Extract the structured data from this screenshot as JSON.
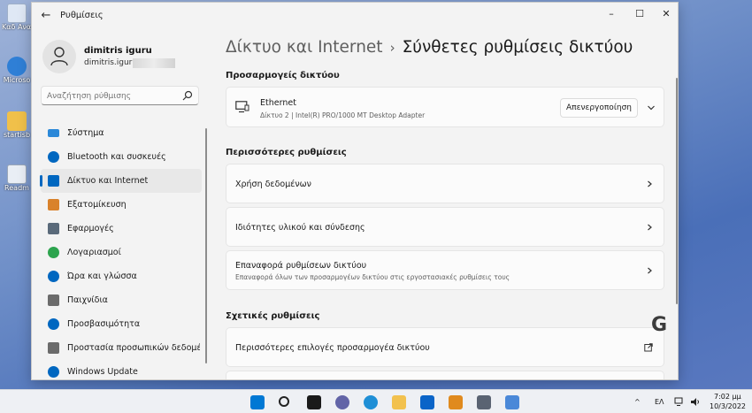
{
  "desktop": {
    "icons": [
      {
        "label": "Καδ Ανακύκλ",
        "color": "#dfe8f5"
      },
      {
        "label": "Microso",
        "color": "#2f7fd6"
      },
      {
        "label": "startisb",
        "color": "#f0c04a"
      },
      {
        "label": "Readm",
        "color": "#e9eef5"
      }
    ]
  },
  "window": {
    "title": "Ρυθμίσεις",
    "back_icon": "back-arrow-icon",
    "controls": {
      "minimize": "–",
      "maximize": "☐",
      "close": "✕"
    }
  },
  "user": {
    "name": "dimitris iguru",
    "email": "dimitris.iguru@"
  },
  "search": {
    "placeholder": "Αναζήτηση ρύθμισης"
  },
  "sidebar": {
    "items": [
      {
        "label": "Σύστημα",
        "icon": "monitor-icon",
        "color": "#2b88d8"
      },
      {
        "label": "Bluetooth και συσκευές",
        "icon": "bluetooth-icon",
        "color": "#0067c0"
      },
      {
        "label": "Δίκτυο και Internet",
        "icon": "wifi-icon",
        "color": "#0067c0",
        "active": true
      },
      {
        "label": "Εξατομίκευση",
        "icon": "brush-icon",
        "color": "#d9822b"
      },
      {
        "label": "Εφαρμογές",
        "icon": "apps-icon",
        "color": "#5a6a7a"
      },
      {
        "label": "Λογαριασμοί",
        "icon": "person-icon",
        "color": "#2da44e"
      },
      {
        "label": "Ώρα και γλώσσα",
        "icon": "globe-clock-icon",
        "color": "#0067c0"
      },
      {
        "label": "Παιχνίδια",
        "icon": "gamepad-icon",
        "color": "#6b6b6b"
      },
      {
        "label": "Προσβασιμότητα",
        "icon": "accessibility-icon",
        "color": "#0067c0"
      },
      {
        "label": "Προστασία προσωπικών δεδομέ",
        "icon": "shield-icon",
        "color": "#6b6b6b"
      },
      {
        "label": "Windows Update",
        "icon": "update-icon",
        "color": "#0067c0"
      }
    ]
  },
  "main": {
    "breadcrumb_parent": "Δίκτυο και Internet",
    "breadcrumb_sep": "›",
    "page_title": "Σύνθετες ρυθμίσεις δικτύου",
    "adapters_label": "Προσαρμογείς δικτύου",
    "adapter": {
      "name": "Ethernet",
      "detail": "Δίκτυο 2 | Intel(R) PRO/1000 MT Desktop Adapter",
      "button": "Απενεργοποίηση"
    },
    "more_label": "Περισσότερες ρυθμίσεις",
    "more_items": [
      {
        "title": "Χρήση δεδομένων",
        "sub": ""
      },
      {
        "title": "Ιδιότητες υλικού και σύνδεσης",
        "sub": ""
      },
      {
        "title": "Επαναφορά ρυθμίσεων δικτύου",
        "sub": "Επαναφορά όλων των προσαρμογέων δικτύου στις εργοστασιακές ρυθμίσεις τους"
      }
    ],
    "related_label": "Σχετικές ρυθμίσεις",
    "related_items": [
      {
        "title": "Περισσότερες επιλογές προσαρμογέα δικτύου",
        "icon": "external-link-icon"
      }
    ]
  },
  "watermark": "G",
  "taskbar": {
    "icons": [
      {
        "name": "start-icon",
        "color": "#0078d4"
      },
      {
        "name": "search-icon",
        "color": "#222222"
      },
      {
        "name": "task-view-icon",
        "color": "#1a1a1a"
      },
      {
        "name": "chat-icon",
        "color": "#6264a7"
      },
      {
        "name": "edge-icon",
        "color": "#1f8fd6"
      },
      {
        "name": "explorer-icon",
        "color": "#f2c14e"
      },
      {
        "name": "mail-icon",
        "color": "#0a64c8"
      },
      {
        "name": "store-icon",
        "color": "#e08a1e"
      },
      {
        "name": "settings-icon",
        "color": "#5a6372"
      },
      {
        "name": "network-app-icon",
        "color": "#4a88d8"
      }
    ],
    "tray": {
      "chevron": "^",
      "language": "ΕΛ",
      "time": "7:02 μμ",
      "date": "10/3/2022"
    }
  }
}
